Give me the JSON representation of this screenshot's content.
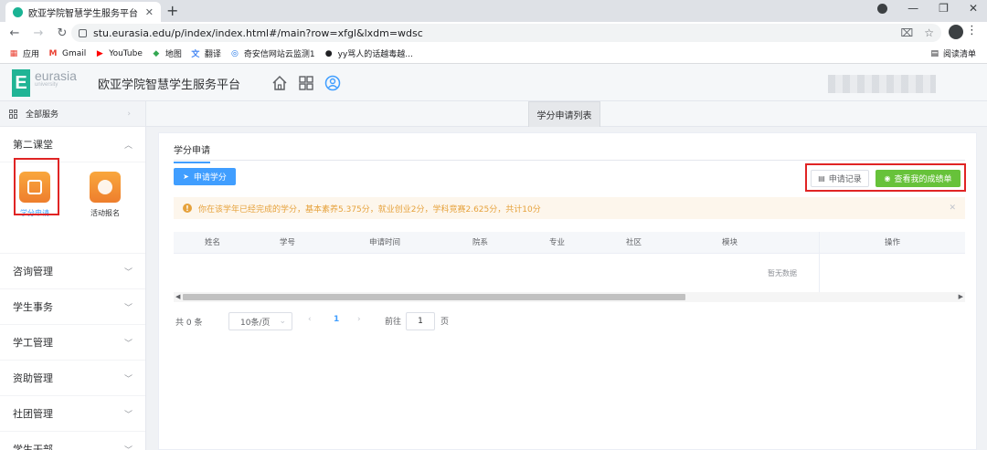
{
  "browser": {
    "tab_title": "欧亚学院智慧学生服务平台",
    "tab_close": "✕",
    "new_tab": "+",
    "url": "stu.eurasia.edu/p/index/index.html#/main?row=xfgl&lxdm=wdsc",
    "bookmarks": [
      {
        "label": "应用",
        "icon": "apps-grid-icon",
        "color": "#ea4335"
      },
      {
        "label": "Gmail",
        "icon": "gmail-icon",
        "color": "#ea4335"
      },
      {
        "label": "YouTube",
        "icon": "youtube-icon",
        "color": "#ff0000"
      },
      {
        "label": "地图",
        "icon": "maps-icon",
        "color": "#34a853"
      },
      {
        "label": "翻译",
        "icon": "translate-icon",
        "color": "#4285f4"
      },
      {
        "label": "奇安信网站云监测1",
        "icon": "shield-icon",
        "color": "#1a73e8"
      },
      {
        "label": "yy骂人的话越毒越...",
        "icon": "link-icon",
        "color": "#202124"
      }
    ],
    "reading_list": "阅读清单"
  },
  "header": {
    "logo_letter": "E",
    "logo_word": "eurasia",
    "logo_sub": "university",
    "title": "欧亚学院智慧学生服务平台"
  },
  "sidebar": {
    "all_services": "全部服务",
    "groups": [
      {
        "label": "第二课堂",
        "expanded": true
      },
      {
        "label": "咨询管理"
      },
      {
        "label": "学生事务"
      },
      {
        "label": "学工管理"
      },
      {
        "label": "资助管理"
      },
      {
        "label": "社团管理"
      },
      {
        "label": "学生干部"
      }
    ],
    "tiles": [
      {
        "label": "学分申请",
        "selected": true
      },
      {
        "label": "活动报名"
      }
    ]
  },
  "page_tab": "学分申请列表",
  "main": {
    "tab": "学分申请",
    "apply_button": "申请学分",
    "record_button": "申请记录",
    "transcript_button": "查看我的成绩单",
    "alert": "你在该学年已经完成的学分，基本素养5.375分，就业创业2分，学科竞赛2.625分，共计10分",
    "table": {
      "columns": [
        "姓名",
        "学号",
        "申请时间",
        "院系",
        "专业",
        "社区",
        "模块",
        "操作"
      ],
      "rows": [],
      "empty_text": "暂无数据"
    },
    "pagination": {
      "total": "共 0 条",
      "page_size": "10条/页",
      "current_page": "1",
      "goto_label": "前往",
      "goto_value": "1",
      "page_unit": "页"
    }
  },
  "colors": {
    "primary": "#409eff",
    "success": "#67c23a",
    "warning": "#e6a23c",
    "brand": "#20b495",
    "highlight": "#e02424"
  }
}
